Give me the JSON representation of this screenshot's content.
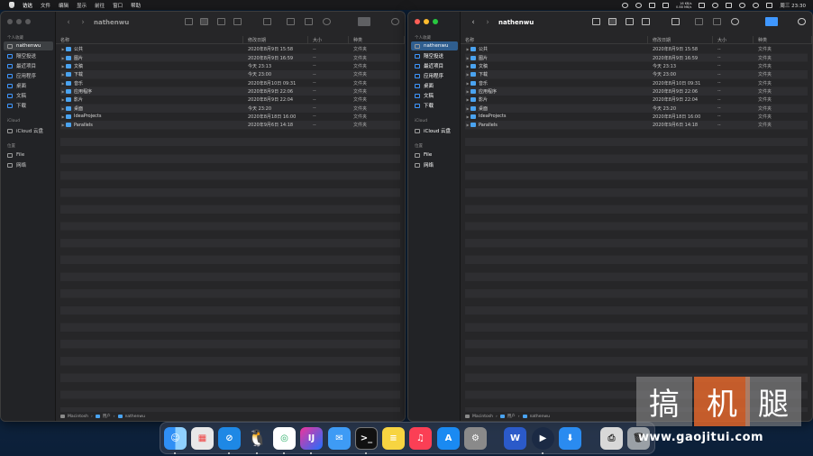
{
  "menubar": {
    "app": "访达",
    "items": [
      "文件",
      "编辑",
      "显示",
      "前往",
      "窗口",
      "帮助"
    ],
    "clock": "周三 23:30",
    "net_up": "16 KB/s",
    "net_down": "0.88 MB/s"
  },
  "sidebar": {
    "section_personal": "个人收藏",
    "items": [
      "nathenwu",
      "隔空投送",
      "最近项目",
      "应用程序",
      "桌面",
      "文稿",
      "下载"
    ],
    "section_icloud": "iCloud",
    "icloud_item": "iCloud 云盘",
    "section_location": "位置",
    "loc_items": [
      "File",
      "网络"
    ]
  },
  "window": {
    "title": "nathenwu",
    "columns": [
      "名称",
      "修改日期",
      "大小",
      "种类"
    ]
  },
  "rows": [
    {
      "name": "公共",
      "date": "2020年8月9日 15:58",
      "size": "--",
      "kind": "文件夹"
    },
    {
      "name": "图片",
      "date": "2020年8月9日 16:59",
      "size": "--",
      "kind": "文件夹"
    },
    {
      "name": "文稿",
      "date": "今天 23:13",
      "size": "--",
      "kind": "文件夹"
    },
    {
      "name": "下载",
      "date": "今天 23:00",
      "size": "--",
      "kind": "文件夹"
    },
    {
      "name": "音乐",
      "date": "2020年8月10日 09:31",
      "size": "--",
      "kind": "文件夹"
    },
    {
      "name": "应用程序",
      "date": "2020年8月9日 22:06",
      "size": "--",
      "kind": "文件夹"
    },
    {
      "name": "影片",
      "date": "2020年8月9日 22:04",
      "size": "--",
      "kind": "文件夹"
    },
    {
      "name": "桌面",
      "date": "今天 23:20",
      "size": "--",
      "kind": "文件夹"
    },
    {
      "name": "IdeaProjects",
      "date": "2020年8月18日 16:00",
      "size": "--",
      "kind": "文件夹"
    },
    {
      "name": "Parallels",
      "date": "2020年9月6日 14:18",
      "size": "--",
      "kind": "文件夹"
    }
  ],
  "path": [
    "Macintosh",
    "用户",
    "nathenwu"
  ],
  "watermark": {
    "chars": [
      "搞",
      "机",
      "腿"
    ],
    "site": "www.gaojitui.com"
  }
}
